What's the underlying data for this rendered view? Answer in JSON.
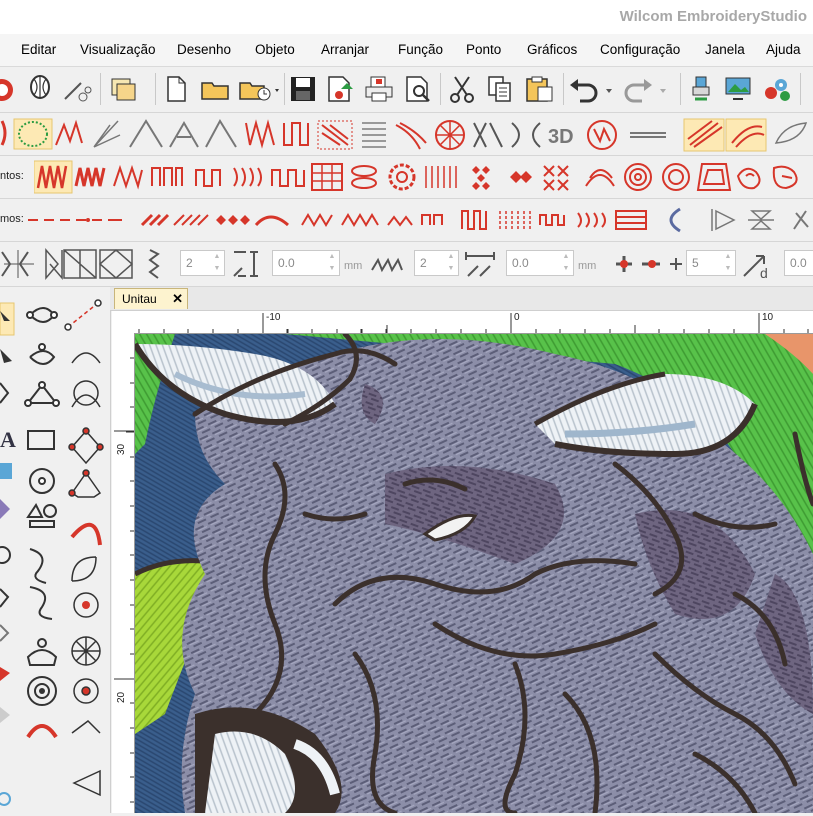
{
  "app": {
    "title": "Wilcom EmbroideryStudio"
  },
  "menu": [
    "Editar",
    "Visualização",
    "Desenho",
    "Objeto",
    "Arranjar",
    "Função",
    "Ponto",
    "Gráficos",
    "Configuração",
    "Janela",
    "Ajuda"
  ],
  "toolbars": {
    "stitch_types_label": "ntos:",
    "effects_label": "mos:"
  },
  "properties": {
    "field1": "2",
    "field2": "0.0",
    "unit1": "mm",
    "field3": "2",
    "field4": "0.0",
    "unit2": "mm",
    "field5": "5",
    "field6": "0.0"
  },
  "document": {
    "tab_label": "Unitau",
    "close_glyph": "✕"
  },
  "ruler": {
    "top_labels": [
      "-10",
      "0",
      "10"
    ],
    "left_labels": [
      "30",
      "20"
    ]
  },
  "colors": {
    "accent_red": "#d6362a",
    "highlight": "#fde9b4",
    "canvas_blue": "#3a5e8c",
    "stitch_gray": "#8c8ea8",
    "outline": "#3b302c",
    "green": "#58c24a",
    "lime": "#a8d83a"
  },
  "icons": [
    "new-file-icon",
    "open-folder-icon",
    "save-icon",
    "print-icon",
    "cut-icon",
    "copy-icon",
    "paste-icon",
    "undo-icon",
    "redo-icon",
    "select-icon",
    "circle-tool-icon",
    "3d-icon"
  ]
}
